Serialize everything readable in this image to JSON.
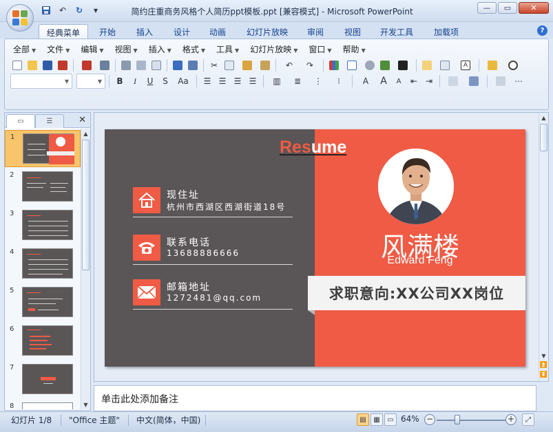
{
  "window": {
    "title": "简约庄重商务风格个人简历ppt模板.ppt [兼容模式] - Microsoft PowerPoint",
    "controls": {
      "minimize": "—",
      "maximize": "▭",
      "close": "✕"
    },
    "help": "?"
  },
  "quick_access": {
    "save": "save-icon",
    "undo": "↶",
    "redo": "↻",
    "customize": "▾"
  },
  "tabs": [
    "经典菜单",
    "开始",
    "插入",
    "设计",
    "动画",
    "幻灯片放映",
    "审阅",
    "视图",
    "开发工具",
    "加载项"
  ],
  "active_tab": "经典菜单",
  "menus": [
    "全部",
    "文件",
    "编辑",
    "视图",
    "插入",
    "格式",
    "工具",
    "幻灯片放映",
    "窗口",
    "帮助"
  ],
  "format_buttons": {
    "bold": "B",
    "italic": "I",
    "underline": "U",
    "strike": "S",
    "case": "Aa",
    "grow": "A",
    "shrink": "A",
    "text_box": "A"
  },
  "panel": {
    "close": "✕"
  },
  "thumbnails": [
    {
      "number": "1",
      "selected": true
    },
    {
      "number": "2"
    },
    {
      "number": "3"
    },
    {
      "number": "4"
    },
    {
      "number": "5"
    },
    {
      "number": "6"
    },
    {
      "number": "7"
    },
    {
      "number": "8"
    }
  ],
  "slide": {
    "title_part1": "Res",
    "title_part2": "ume",
    "address_label": "现住址",
    "address_value": "杭州市西湖区西湖街道18号",
    "phone_label": "联系电话",
    "phone_value": "13688886666",
    "email_label": "邮箱地址",
    "email_value": "1272481@qq.com",
    "name_cn": "风满楼",
    "name_en": "Edward Feng",
    "job_intent": "求职意向:XX公司XX岗位",
    "colors": {
      "accent": "#ef5b45",
      "dark": "#5a5556"
    }
  },
  "notes_placeholder": "单击此处添加备注",
  "status": {
    "slide_info": "幻灯片 1/8",
    "theme": "\"Office 主题\"",
    "language": "中文(简体，中国)",
    "zoom": "64%",
    "zoom_out": "−",
    "zoom_in": "+"
  }
}
